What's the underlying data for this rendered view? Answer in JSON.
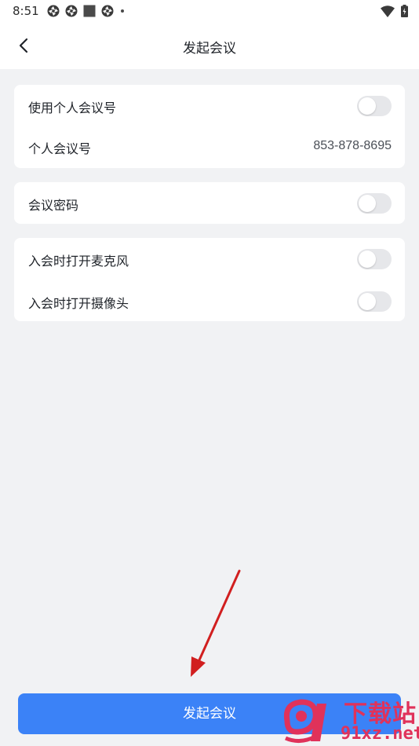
{
  "status_bar": {
    "time": "8:51"
  },
  "header": {
    "title": "发起会议"
  },
  "card1": {
    "personal_meeting_id_toggle_label": "使用个人会议号",
    "personal_meeting_id_toggle_on": false,
    "personal_meeting_id_label": "个人会议号",
    "personal_meeting_id_value": "853-878-8695"
  },
  "card2": {
    "password_label": "会议密码",
    "password_on": false
  },
  "card3": {
    "mic_label": "入会时打开麦克风",
    "mic_on": false,
    "camera_label": "入会时打开摄像头",
    "camera_on": false
  },
  "footer": {
    "start_button_label": "发起会议"
  },
  "watermark": {
    "line1": "下载站",
    "line2": "91xz.net"
  },
  "colors": {
    "accent": "#3b82f7",
    "background": "#f1f2f4",
    "card": "#ffffff",
    "toggle_off": "#e6e7ea",
    "annotation_arrow": "#d11f1f",
    "watermark": "#e0325a"
  }
}
